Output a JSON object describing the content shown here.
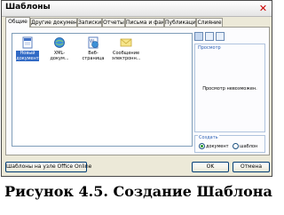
{
  "dialog": {
    "title": "Шаблоны",
    "close_icon": "close-icon"
  },
  "tabs": [
    {
      "label": "Общие",
      "active": true
    },
    {
      "label": "Другие документы"
    },
    {
      "label": "Записки"
    },
    {
      "label": "Отчеты"
    },
    {
      "label": "Письма и факсы"
    },
    {
      "label": "Публикации"
    },
    {
      "label": "Слияние"
    }
  ],
  "templates": [
    {
      "label": "Новый документ",
      "icon": "blank-document-icon",
      "selected": true
    },
    {
      "label": "XML-докум...",
      "icon": "xml-document-icon"
    },
    {
      "label": "Веб-страница",
      "icon": "web-page-icon"
    },
    {
      "label": "Сообщение электронн...",
      "icon": "email-message-icon"
    }
  ],
  "view_buttons": [
    "large-icons-view-icon",
    "list-view-icon",
    "details-view-icon"
  ],
  "preview": {
    "label": "Просмотр",
    "message": "Просмотр невозможен."
  },
  "create": {
    "label": "Создать",
    "options": [
      {
        "label": "документ",
        "selected": true
      },
      {
        "label": "шаблон",
        "selected": false
      }
    ]
  },
  "buttons": {
    "online": "Шаблоны на узле Office Online",
    "ok": "OK",
    "cancel": "Отмена"
  },
  "caption": "Рисунок 4.5. Создание Шаблона"
}
